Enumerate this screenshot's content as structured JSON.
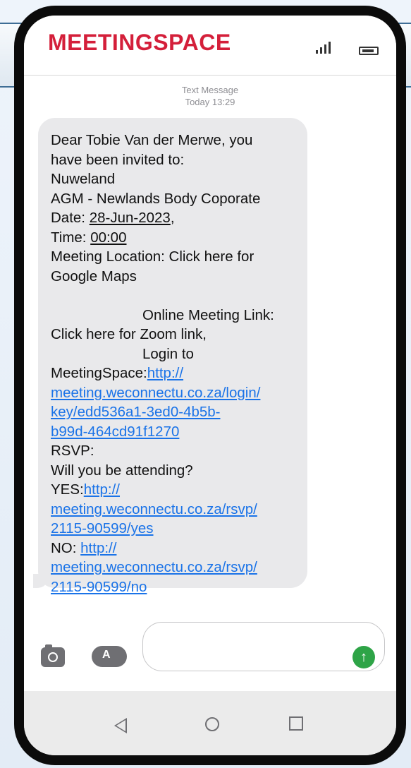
{
  "header": {
    "logo_text": "MEETINGSPACE",
    "logo_color": "#d41f3a",
    "status_icons": [
      "signal-icon",
      "battery-icon"
    ]
  },
  "message_meta": {
    "type": "Text Message",
    "time": "Today 13:29"
  },
  "message": {
    "greeting": "Dear Tobie Van der Merwe, you",
    "invited": "have been invited to:",
    "organisation": "Nuweland",
    "meeting": "AGM - Newlands Body Coporate",
    "date_label": "Date: ",
    "date_value": "28-Jun-2023",
    "date_suffix": ",",
    "time_label": "Time: ",
    "time_value": "00:00",
    "location_line1": "Meeting Location: Click here for",
    "location_line2": "Google Maps",
    "online_link": "Online Meeting Link:",
    "zoom_link": "Click here for Zoom link,",
    "login_to": "Login to",
    "meetingspace_label": "MeetingSpace:",
    "login_link": {
      "line1": "http://",
      "line2": "meeting.weconnectu.co.za/login/",
      "line3": "key/edd536a1-3ed0-4b5b-",
      "line4": "b99d-464cd91f1270"
    },
    "rsvp": "RSVP:",
    "question": "Will you be attending?",
    "yes_label": "YES:",
    "yes_link": {
      "line1": "http://",
      "line2": "meeting.weconnectu.co.za/rsvp/",
      "line3": "2115-90599/yes"
    },
    "no_label": "NO: ",
    "no_link": {
      "line1": "http://",
      "line2": "meeting.weconnectu.co.za/rsvp/",
      "line3": "2115-90599/no"
    },
    "link_color": "#1a73e8"
  },
  "composer": {
    "input_value": "",
    "send_color": "#2ea447"
  },
  "nav": {
    "icons": [
      "back-icon",
      "home-icon",
      "recents-icon"
    ]
  }
}
